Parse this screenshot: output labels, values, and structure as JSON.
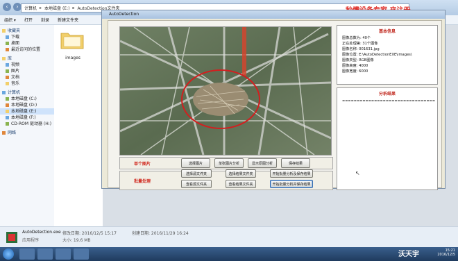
{
  "explorer": {
    "address": [
      "计算机",
      "本地磁盘 (E:)",
      "AutoDetection文件夹"
    ],
    "toolbar": [
      "组织 ▾",
      "打开",
      "刻录",
      "新建文件夹"
    ],
    "sidebar": [
      {
        "label": "收藏夹",
        "group": true
      },
      {
        "label": "下载"
      },
      {
        "label": "桌面"
      },
      {
        "label": "最近访问的位置"
      },
      {
        "label": "库",
        "group": true
      },
      {
        "label": "视频"
      },
      {
        "label": "图片"
      },
      {
        "label": "文档"
      },
      {
        "label": "音乐"
      },
      {
        "label": "计算机",
        "group": true
      },
      {
        "label": "本地磁盘 (C:)"
      },
      {
        "label": "本地磁盘 (D:)"
      },
      {
        "label": "本地磁盘 (E:)",
        "selected": true
      },
      {
        "label": "本地磁盘 (F:)"
      },
      {
        "label": "CD-ROM 驱动器 (H:)"
      },
      {
        "label": "网络",
        "group": true
      }
    ],
    "folder_name": "images",
    "status": {
      "filename": "AutoDetection.exe",
      "modified": "修改日期: 2016/12/5 15:17",
      "created": "创建日期: 2016/11/29 16:24",
      "type": "应用程序",
      "size": "大小: 19.6 MB"
    },
    "clock": {
      "time": "15:21",
      "date": "2016/12/5"
    },
    "watermark": "秒懂设备专家 来注册"
  },
  "app": {
    "title": "AutoDetection",
    "info_panel": {
      "title": "基本信息",
      "lines": [
        "图像总数为: 40个",
        "正在处理第: 31个图像",
        "图像名称: 001631.jpg",
        "图像位置: E:\\AutoDetectionEXE\\images\\",
        "图像类型: RGB图像",
        "图像高度: 4000",
        "图像宽度: 6000"
      ]
    },
    "result_panel": {
      "title": "分析结果",
      "content": "================================"
    },
    "single_group": {
      "label": "单个图片",
      "buttons": [
        "选择图片",
        "单张图片分析",
        "显示原图分析",
        "保存结果"
      ]
    },
    "batch_group": {
      "label": "批量处理",
      "buttons_row1": [
        "选择源文件夹",
        "选择结果文件夹",
        "开始批量分析及保存结果"
      ],
      "buttons_row2": [
        "查看源文件夹",
        "查看结果文件夹",
        "开始批量分析并保存结果"
      ]
    }
  },
  "wechat_badge": "沃天宇",
  "colors": {
    "accent_red": "#c0281e",
    "window_blue": "#a8c2e0"
  }
}
